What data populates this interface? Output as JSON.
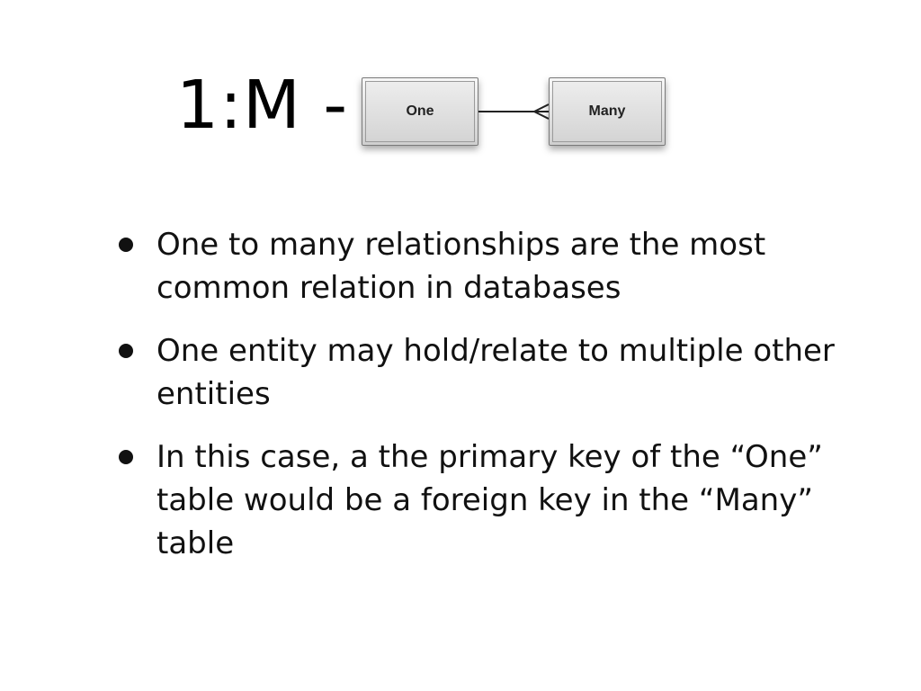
{
  "slide": {
    "title": "1:M -",
    "diagram": {
      "left_entity": "One",
      "right_entity": "Many"
    },
    "bullets": [
      "One to many relationships are the most common relation in databases",
      "One entity may hold/relate to multiple other entities",
      "In this case, a the primary key of the “One” table would be a foreign key in the “Many” table"
    ]
  }
}
